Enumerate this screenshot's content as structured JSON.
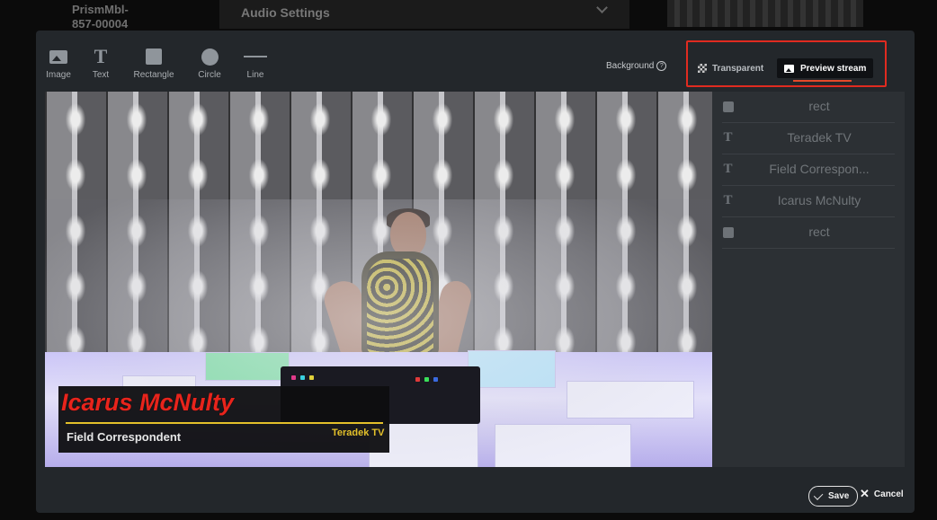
{
  "background_page": {
    "device_title": "PrismMbl-\n857-00004",
    "audio_settings_label": "Audio Settings"
  },
  "toolbar": {
    "tools": [
      {
        "label": "Image",
        "icon": "image-icon"
      },
      {
        "label": "Text",
        "icon": "text-icon"
      },
      {
        "label": "Rectangle",
        "icon": "rectangle-icon"
      },
      {
        "label": "Circle",
        "icon": "circle-icon"
      },
      {
        "label": "Line",
        "icon": "line-icon"
      }
    ],
    "background_label": "Background",
    "background_options": {
      "transparent": "Transparent",
      "preview_stream": "Preview stream",
      "selected": "Preview stream"
    },
    "highlight_color": "#e02b20"
  },
  "overlay": {
    "name": "Icarus McNulty",
    "role": "Field Correspondent",
    "brand": "Teradek TV",
    "name_color": "#e8241c",
    "accent_color": "#e3c02a"
  },
  "layers": [
    {
      "type": "rect",
      "label": "rect"
    },
    {
      "type": "text",
      "label": "Teradek TV"
    },
    {
      "type": "text",
      "label": "Field Correspon..."
    },
    {
      "type": "text",
      "label": "Icarus McNulty"
    },
    {
      "type": "rect",
      "label": "rect"
    }
  ],
  "footer": {
    "save_label": "Save",
    "cancel_label": "Cancel"
  }
}
